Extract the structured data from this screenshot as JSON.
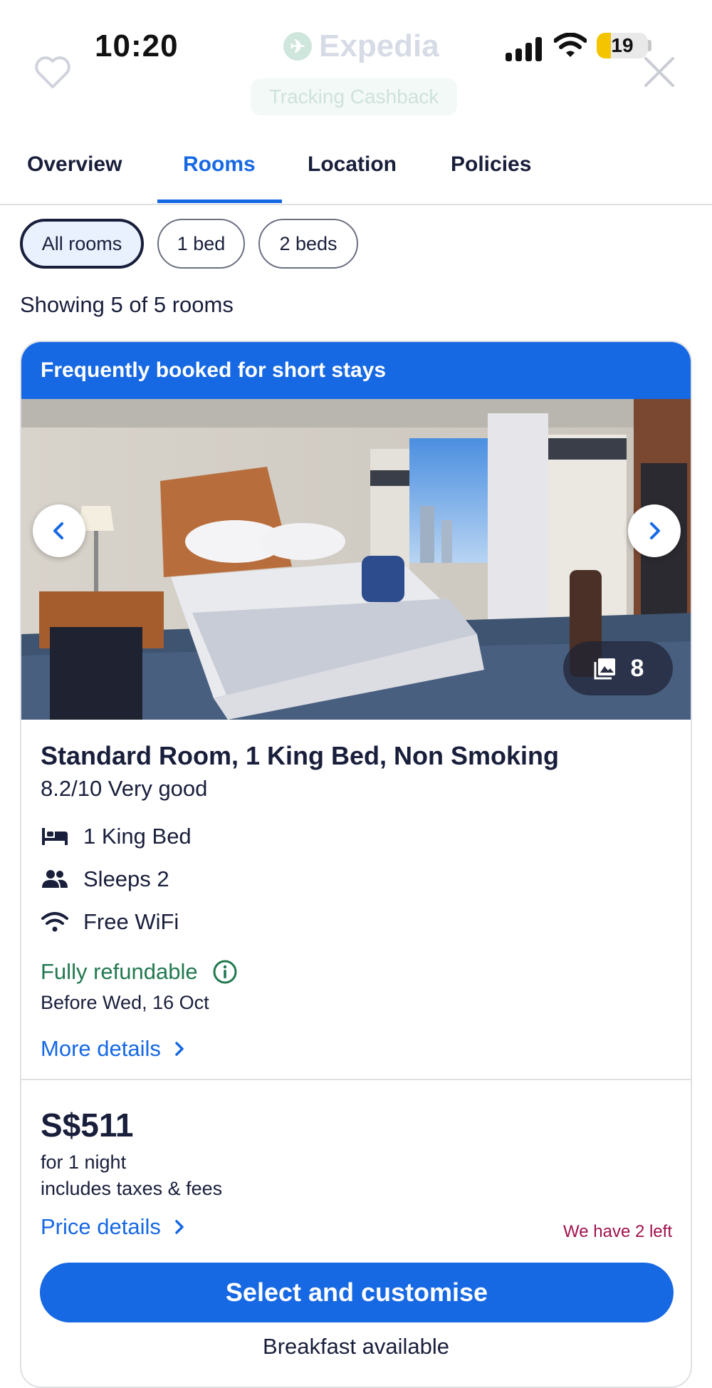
{
  "status_bar": {
    "time": "10:20",
    "battery": "19"
  },
  "header": {
    "brand": "Expedia",
    "cashback_label": "Tracking Cashback"
  },
  "tabs": [
    {
      "label": "Overview"
    },
    {
      "label": "Rooms",
      "active": true
    },
    {
      "label": "Location"
    },
    {
      "label": "Policies"
    }
  ],
  "filters": [
    {
      "label": "All rooms",
      "active": true
    },
    {
      "label": "1 bed"
    },
    {
      "label": "2 beds"
    }
  ],
  "showing_text": "Showing 5 of 5 rooms",
  "room": {
    "banner": "Frequently booked for short stays",
    "photo_count": "8",
    "title": "Standard Room, 1 King Bed, Non Smoking",
    "rating": "8.2/10 Very good",
    "amenities": [
      {
        "icon": "bed-icon",
        "label": "1 King Bed"
      },
      {
        "icon": "people-icon",
        "label": "Sleeps 2"
      },
      {
        "icon": "wifi-icon",
        "label": "Free WiFi"
      }
    ],
    "refund_label": "Fully refundable",
    "refund_deadline": "Before Wed, 16 Oct",
    "more_details": "More details",
    "price": "S$511",
    "price_period": "for 1 night",
    "price_note": "includes taxes & fees",
    "price_details": "Price details",
    "availability": "We have 2 left",
    "cta": "Select and customise",
    "breakfast": "Breakfast available"
  },
  "colors": {
    "accent": "#1668e3",
    "refund": "#227950",
    "urgency": "#a0114d",
    "text": "#191e3b"
  }
}
